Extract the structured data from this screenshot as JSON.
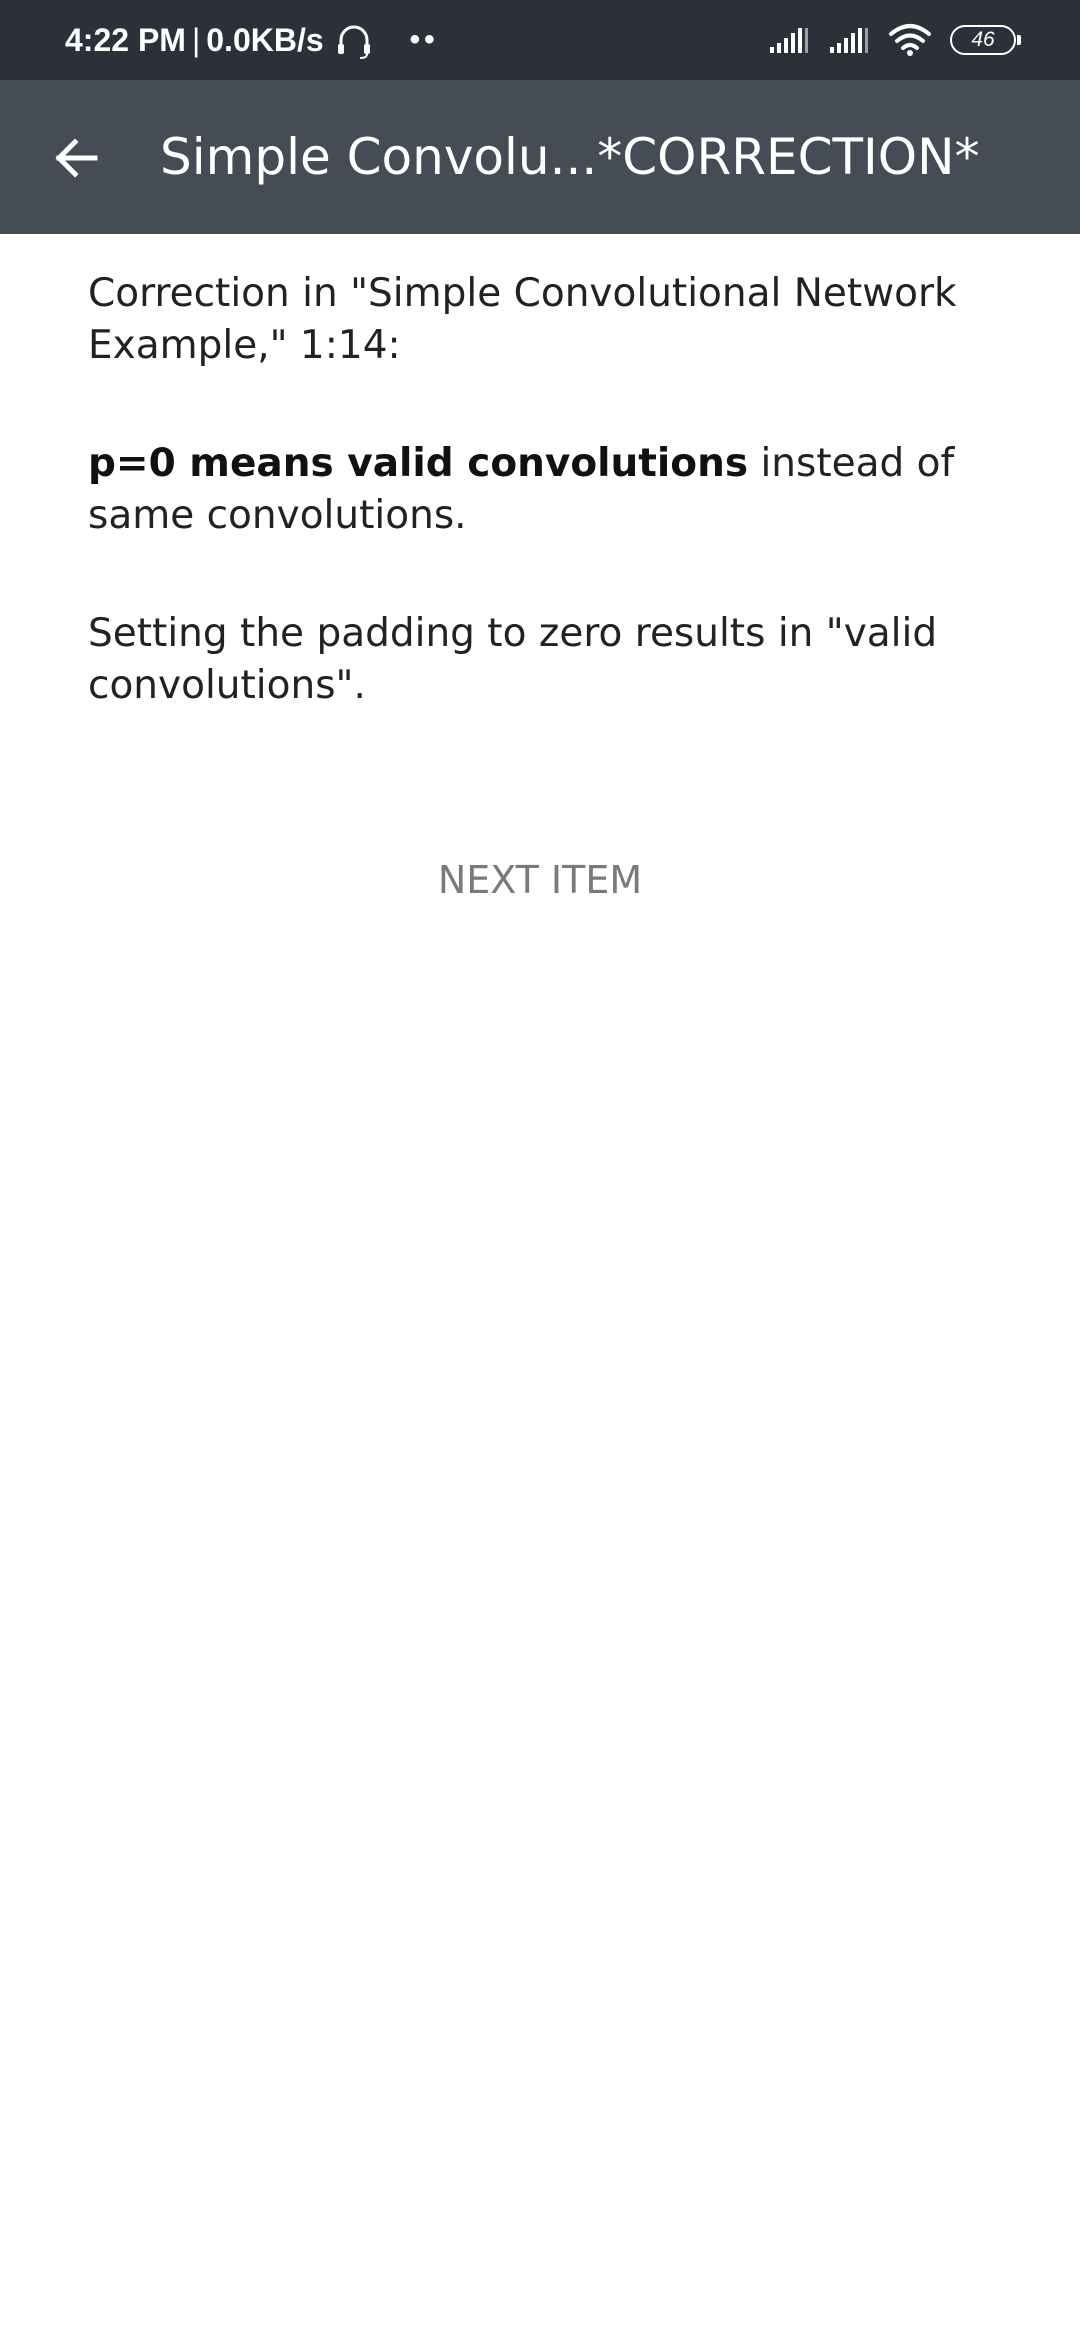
{
  "status_bar": {
    "time": "4:22 PM",
    "separator": "|",
    "speed": "0.0KB/s",
    "dots": "••",
    "battery": "46",
    "icons": [
      "headset-icon",
      "signal-icon",
      "signal-icon",
      "wifi-icon",
      "battery-icon"
    ]
  },
  "header": {
    "title": "Simple Convolu...*CORRECTION*",
    "back_icon": "arrow-left-icon"
  },
  "content": {
    "para1": "Correction in \"Simple Convolutional Network Example,\" 1:14:",
    "para2_bold": "p=0 means valid convolutions",
    "para2_rest": " instead of same convolutions.",
    "para3": "Setting the padding to zero results in \"valid convolutions\"."
  },
  "actions": {
    "next_item": "NEXT ITEM"
  },
  "colors": {
    "status_bar_bg": "#2c3038",
    "app_bar_bg": "#464c56",
    "body_text": "#222222",
    "next_item_text": "#7a7a7a"
  }
}
